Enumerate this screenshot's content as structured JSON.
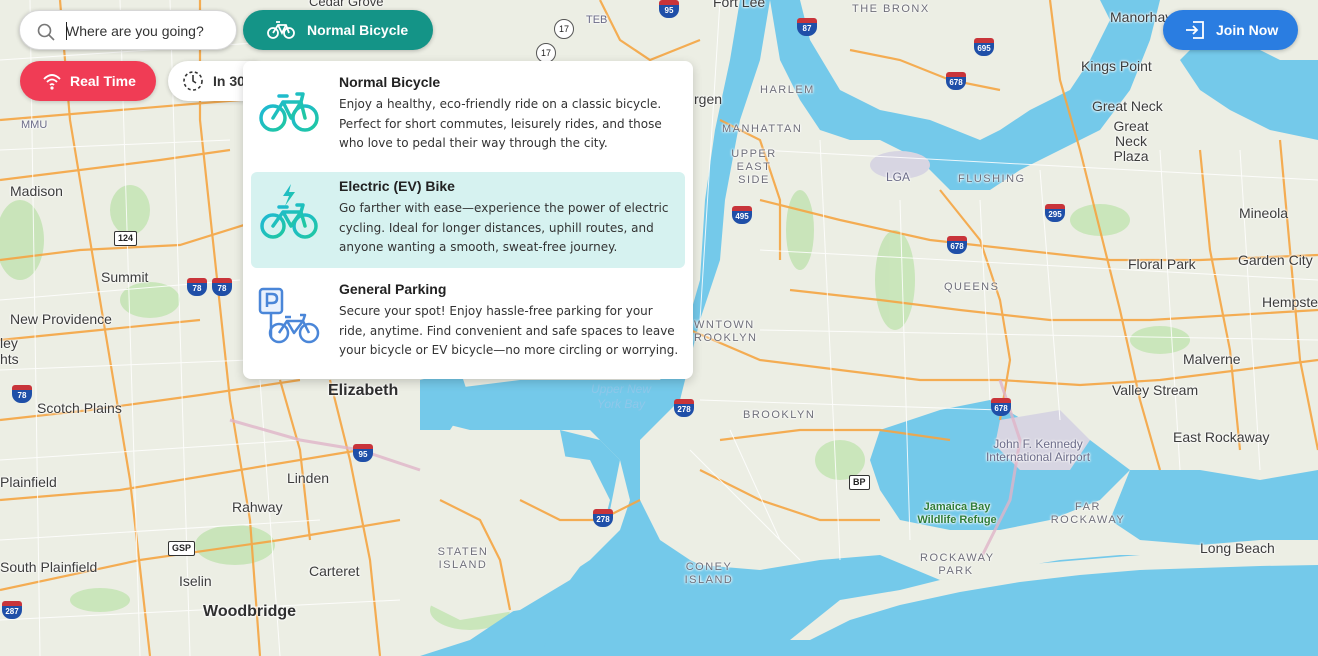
{
  "search": {
    "placeholder": "Where are you going?"
  },
  "mode_selector": {
    "label": "Normal Bicycle",
    "icon": "bicycle-icon",
    "color": "#149487"
  },
  "time_mode": {
    "realtime_label": "Real Time",
    "realtime_icon": "wifi-icon",
    "realtime_color": "#f03c55",
    "later_label": "In 30",
    "later_icon": "clock-dashed-icon"
  },
  "join": {
    "label": "Join Now",
    "icon": "login-icon",
    "color": "#2a7de1"
  },
  "vehicle_options": [
    {
      "title": "Normal Bicycle",
      "description": "Enjoy a healthy, eco-friendly ride on a classic bicycle. Perfect for short commutes, leisurely rides, and those who love to pedal their way through the city.",
      "icon": "bicycle-icon",
      "selected": false
    },
    {
      "title": "Electric (EV) Bike",
      "description": "Go farther with ease—experience the power of electric cycling. Ideal for longer distances, uphill routes, and anyone wanting a smooth, sweat-free journey.",
      "icon": "electric-bike-icon",
      "selected": true
    },
    {
      "title": "General Parking",
      "description": "Secure your spot! Enjoy hassle-free parking for your ride, anytime. Find convenient and safe spaces to leave your bicycle or EV bicycle—no more circling or worrying.",
      "icon": "parking-bike-icon",
      "selected": false
    }
  ],
  "map_labels": {
    "cedar_grove": "Cedar Grove",
    "fort_lee": "Fort Lee",
    "the_bronx": "THE BRONX",
    "manorhaven": "Manorhaven",
    "teb": "TEB",
    "mmu": "MMU",
    "kings_point": "Kings Point",
    "great_neck": "Great Neck",
    "great_neck_plaza": "Great Neck Plaza",
    "bergen": "rgen",
    "harlem": "HARLEM",
    "manhattan": "MANHATTAN",
    "upper_east_side": "UPPER EAST SIDE",
    "lga": "LGA",
    "flushing": "FLUSHING",
    "madison": "Madison",
    "mineola": "Mineola",
    "garden_city": "Garden City",
    "summit": "Summit",
    "floral_park": "Floral Park",
    "hempstead": "Hempste",
    "queens": "QUEENS",
    "new_providence": "New Providence",
    "heights": "hts",
    "ley": "ley",
    "downtown_brooklyn": "WNTOWN ROOKLYN",
    "malverne": "Malverne",
    "elizabeth": "Elizabeth",
    "upper_ny_bay": "Upper New York Bay",
    "valley_stream": "Valley Stream",
    "scotch_plains": "Scotch Plains",
    "brooklyn": "BROOKLYN",
    "jfk": "John F. Kennedy International Airport",
    "east_rockaway": "East Rockaway",
    "plainfield": "Plainfield",
    "linden": "Linden",
    "rahway": "Rahway",
    "jamaica_bay": "Jamaica Bay Wildlife Refuge",
    "far_rockaway": "FAR ROCKAWAY",
    "staten_island": "STATEN ISLAND",
    "long_beach": "Long Beach",
    "carteret": "Carteret",
    "rockaway_park": "ROCKAWAY PARK",
    "south_plainfield": "South Plainfield",
    "coney_island": "CONEY ISLAND",
    "iselin": "Iselin",
    "woodbridge": "Woodbridge"
  },
  "route_shields": [
    "17",
    "95",
    "87",
    "17",
    "695",
    "678",
    "124",
    "78",
    "78",
    "495",
    "295",
    "678",
    "78",
    "678",
    "95",
    "278",
    "BP",
    "GSP",
    "278",
    "287"
  ]
}
